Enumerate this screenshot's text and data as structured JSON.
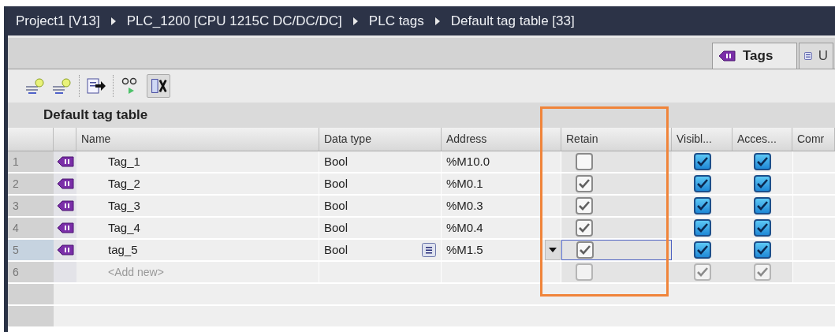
{
  "breadcrumb": [
    "Project1 [V13]",
    "PLC_1200 [CPU 1215C DC/DC/DC]",
    "PLC tags",
    "Default tag table [33]"
  ],
  "tabs": [
    {
      "label": "Tags",
      "selected": true
    },
    {
      "label": "U",
      "selected": false
    }
  ],
  "table": {
    "title": "Default tag table",
    "columns": [
      "Name",
      "Data type",
      "Address",
      "Retain",
      "Visibl...",
      "Acces...",
      "Comr"
    ],
    "rows": [
      {
        "number": "1",
        "name": "Tag_1",
        "data_type": "Bool",
        "address": "%M10.0",
        "selected": false,
        "retain": {
          "checked": false,
          "disabled": false
        },
        "visible": {
          "checked": true,
          "disabled": false
        },
        "accessible": {
          "checked": true,
          "disabled": false
        }
      },
      {
        "number": "2",
        "name": "Tag_2",
        "data_type": "Bool",
        "address": "%M0.1",
        "selected": false,
        "retain": {
          "checked": true,
          "disabled": false
        },
        "visible": {
          "checked": true,
          "disabled": false
        },
        "accessible": {
          "checked": true,
          "disabled": false
        }
      },
      {
        "number": "3",
        "name": "Tag_3",
        "data_type": "Bool",
        "address": "%M0.3",
        "selected": false,
        "retain": {
          "checked": true,
          "disabled": false
        },
        "visible": {
          "checked": true,
          "disabled": false
        },
        "accessible": {
          "checked": true,
          "disabled": false
        }
      },
      {
        "number": "4",
        "name": "Tag_4",
        "data_type": "Bool",
        "address": "%M0.4",
        "selected": false,
        "retain": {
          "checked": true,
          "disabled": false
        },
        "visible": {
          "checked": true,
          "disabled": false
        },
        "accessible": {
          "checked": true,
          "disabled": false
        }
      },
      {
        "number": "5",
        "name": "tag_5",
        "data_type": "Bool",
        "address": "%M1.5",
        "selected": true,
        "retain": {
          "checked": true,
          "disabled": false
        },
        "visible": {
          "checked": true,
          "disabled": false
        },
        "accessible": {
          "checked": true,
          "disabled": false
        }
      },
      {
        "number": "6",
        "placeholder": "<Add new>",
        "selected": false,
        "retain": {
          "checked": false,
          "disabled": true
        },
        "visible": {
          "checked": true,
          "disabled": true
        },
        "accessible": {
          "checked": true,
          "disabled": true
        }
      }
    ]
  }
}
